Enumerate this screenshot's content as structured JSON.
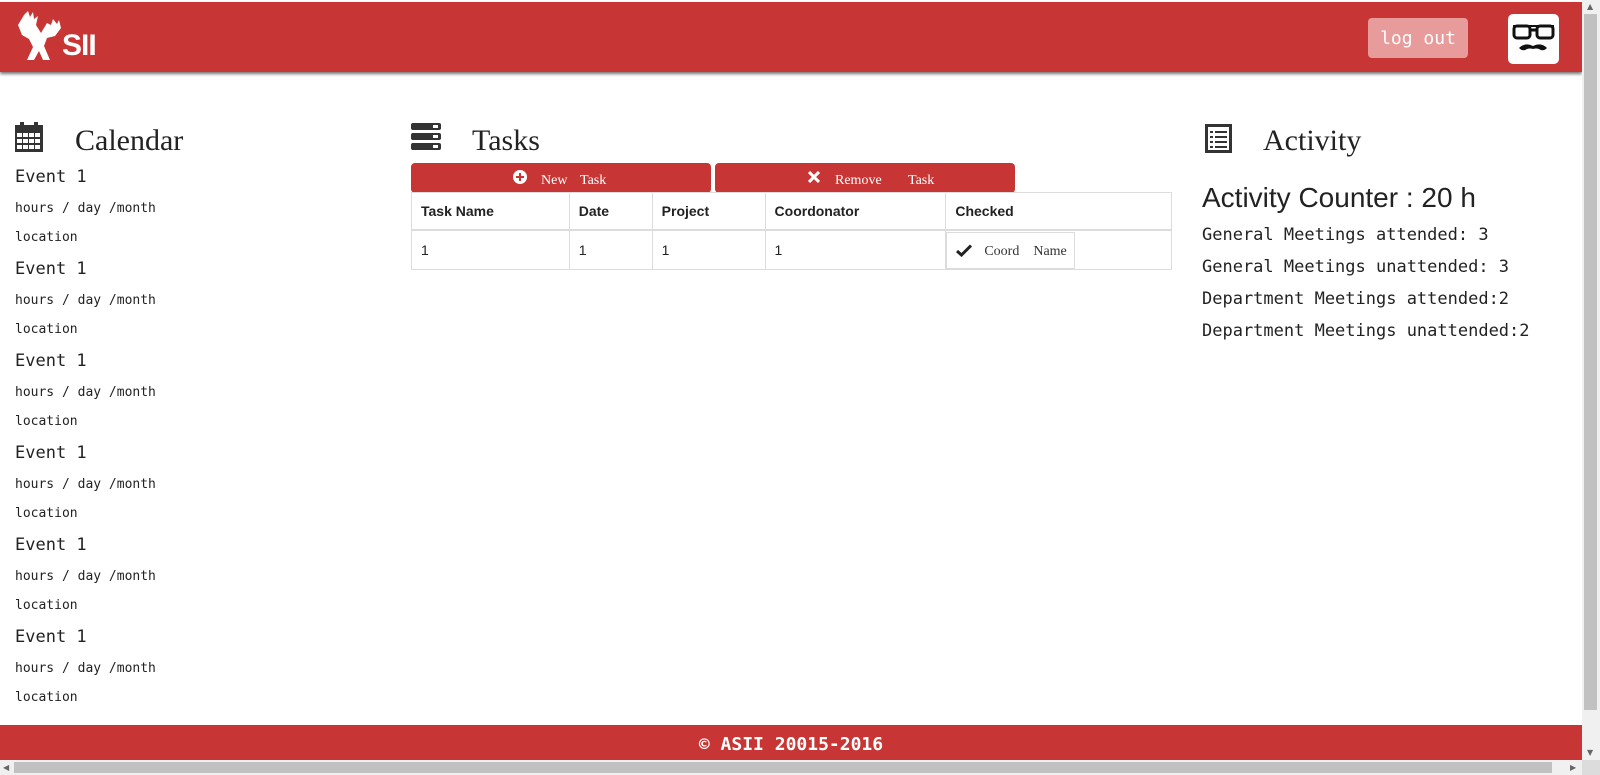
{
  "header": {
    "logo_text": "SII",
    "logout_label": "log out",
    "avatar_icon": "glasses-mustache-icon"
  },
  "calendar": {
    "title": "Calendar",
    "icon": "calendar-icon",
    "events": [
      {
        "name": "Event 1",
        "time": "hours / day /month",
        "location": "location"
      },
      {
        "name": "Event 1",
        "time": "hours / day /month",
        "location": "location"
      },
      {
        "name": "Event 1",
        "time": "hours / day /month",
        "location": "location"
      },
      {
        "name": "Event 1",
        "time": "hours / day /month",
        "location": "location"
      },
      {
        "name": "Event 1",
        "time": "hours / day /month",
        "location": "location"
      },
      {
        "name": "Event 1",
        "time": "hours / day /month",
        "location": "location"
      }
    ]
  },
  "tasks": {
    "title": "Tasks",
    "icon": "server-stack-icon",
    "new_label_1": "New",
    "new_label_2": "Task",
    "remove_label_1": "Remove",
    "remove_label_2": "Task",
    "columns": [
      "Task Name",
      "Date",
      "Project",
      "Coordonator",
      "Checked"
    ],
    "rows": [
      {
        "task_name": "1",
        "date": "1",
        "project": "1",
        "coordonator": "1",
        "checked_label_1": "Coord",
        "checked_label_2": "Name"
      }
    ]
  },
  "activity": {
    "title": "Activity",
    "icon": "list-icon",
    "counter": "Activity Counter : 20 h",
    "lines": [
      "General Meetings attended: 3",
      "General Meetings unattended: 3",
      "Department Meetings attended:2",
      "Department Meetings unattended:2"
    ]
  },
  "footer": {
    "text": "© ASII 20015-2016"
  },
  "colors": {
    "brand_red": "#c73634",
    "logout_bg": "#e79c9b"
  }
}
